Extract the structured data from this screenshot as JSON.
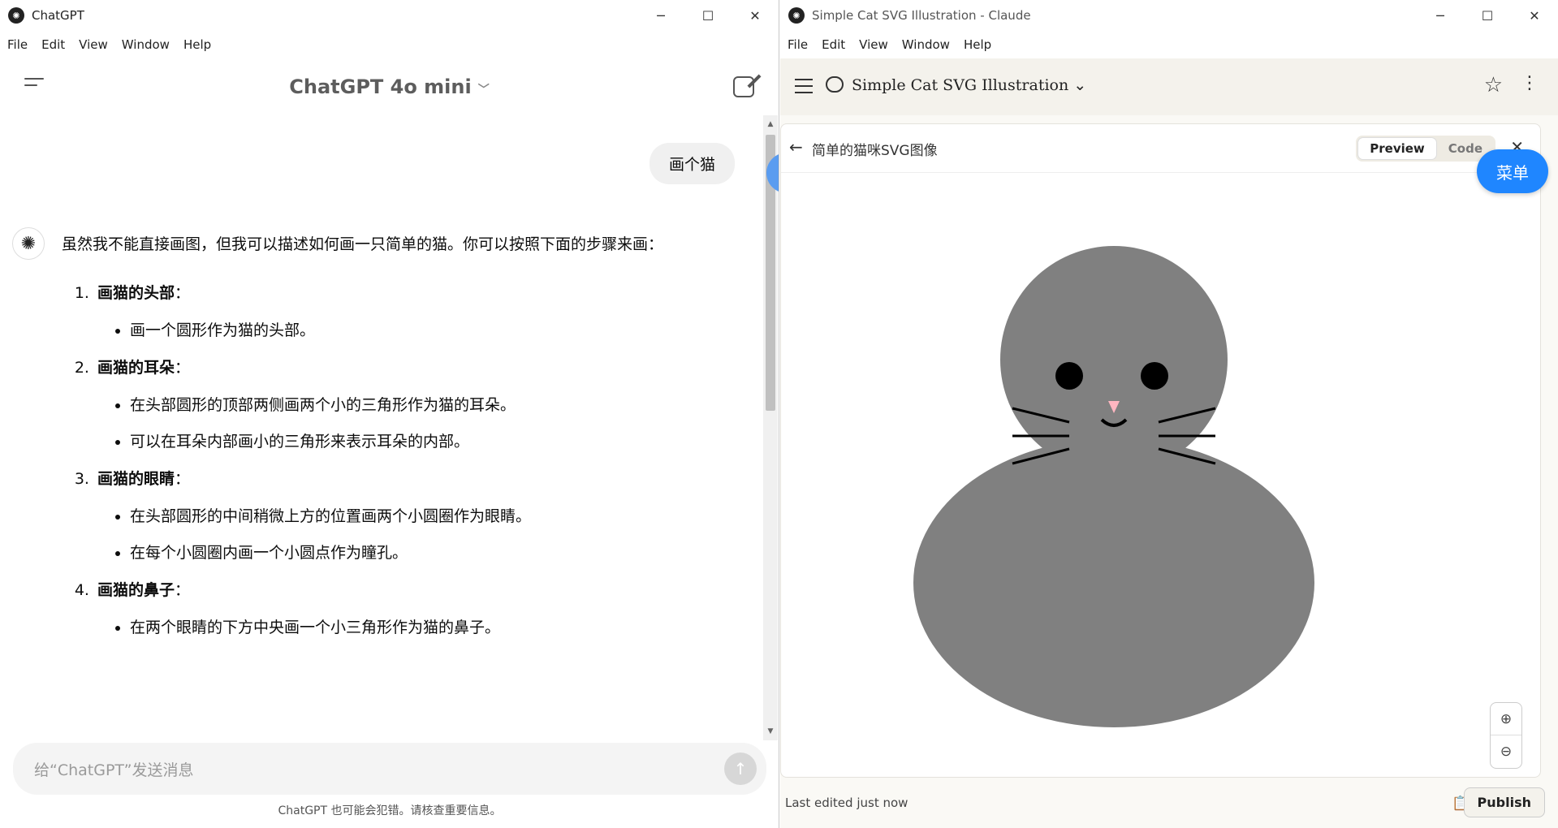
{
  "left": {
    "title": "ChatGPT",
    "menu": [
      "File",
      "Edit",
      "View",
      "Window",
      "Help"
    ],
    "model": "ChatGPT 4o mini",
    "user_msg": "画个猫",
    "intro": "虽然我不能直接画图，但我可以描述如何画一只简单的猫。你可以按照下面的步骤来画：",
    "steps": [
      {
        "title": "画猫的头部",
        "colon": "：",
        "items": [
          "画一个圆形作为猫的头部。"
        ]
      },
      {
        "title": "画猫的耳朵",
        "colon": "：",
        "items": [
          "在头部圆形的顶部两侧画两个小的三角形作为猫的耳朵。",
          "可以在耳朵内部画小的三角形来表示耳朵的内部。"
        ]
      },
      {
        "title": "画猫的眼睛",
        "colon": "：",
        "items": [
          "在头部圆形的中间稍微上方的位置画两个小圆圈作为眼睛。",
          "在每个小圆圈内画一个小圆点作为瞳孔。"
        ]
      },
      {
        "title": "画猫的鼻子",
        "colon": "：",
        "items": [
          "在两个眼睛的下方中央画一个小三角形作为猫的鼻子。"
        ]
      }
    ],
    "placeholder": "给“ChatGPT”发送消息",
    "disclaimer": "ChatGPT 也可能会犯错。请核查重要信息。"
  },
  "right": {
    "title": "Simple Cat SVG Illustration - Claude",
    "menu": [
      "File",
      "Edit",
      "View",
      "Window",
      "Help"
    ],
    "conv_title": "Simple Cat SVG Illustration",
    "artifact_title": "简单的猫咪SVG图像",
    "preview": "Preview",
    "code": "Code",
    "menu_btn": "菜单",
    "last_edited": "Last edited just now",
    "publish": "Publish"
  },
  "colors": {
    "cat": "#808080",
    "nose": "#ffb6c1",
    "accent": "#1f86ff"
  }
}
